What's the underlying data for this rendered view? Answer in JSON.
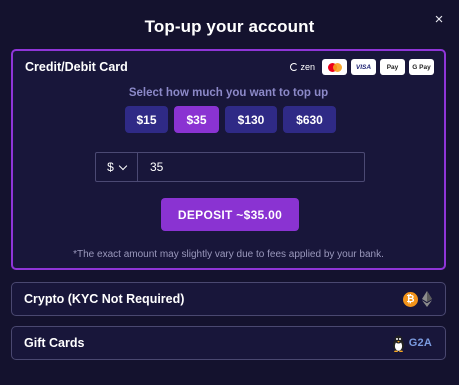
{
  "header": {
    "title": "Top-up your account",
    "close_glyph": "×"
  },
  "card_section": {
    "title": "Credit/Debit Card",
    "logos": {
      "zen": "zen",
      "visa": "VISA",
      "apple_pay": " Pay",
      "google_pay": "G Pay"
    },
    "select_label": "Select how much you want to top up",
    "amounts": [
      "$15",
      "$35",
      "$130",
      "$630"
    ],
    "selected_amount": "$35",
    "currency": "$",
    "amount_value": "35",
    "deposit_label": "DEPOSIT ~$35.00",
    "note": "*The exact amount may slightly vary due to fees applied by your bank."
  },
  "crypto_section": {
    "label": "Crypto (KYC Not Required)",
    "btc_glyph": "₿"
  },
  "giftcards_section": {
    "label": "Gift Cards",
    "g2a_text": "G2A"
  },
  "colors": {
    "background": "#14122e",
    "accent": "#8a33d2",
    "amount_button": "#2f2a86",
    "muted_text": "#8c89c8"
  }
}
